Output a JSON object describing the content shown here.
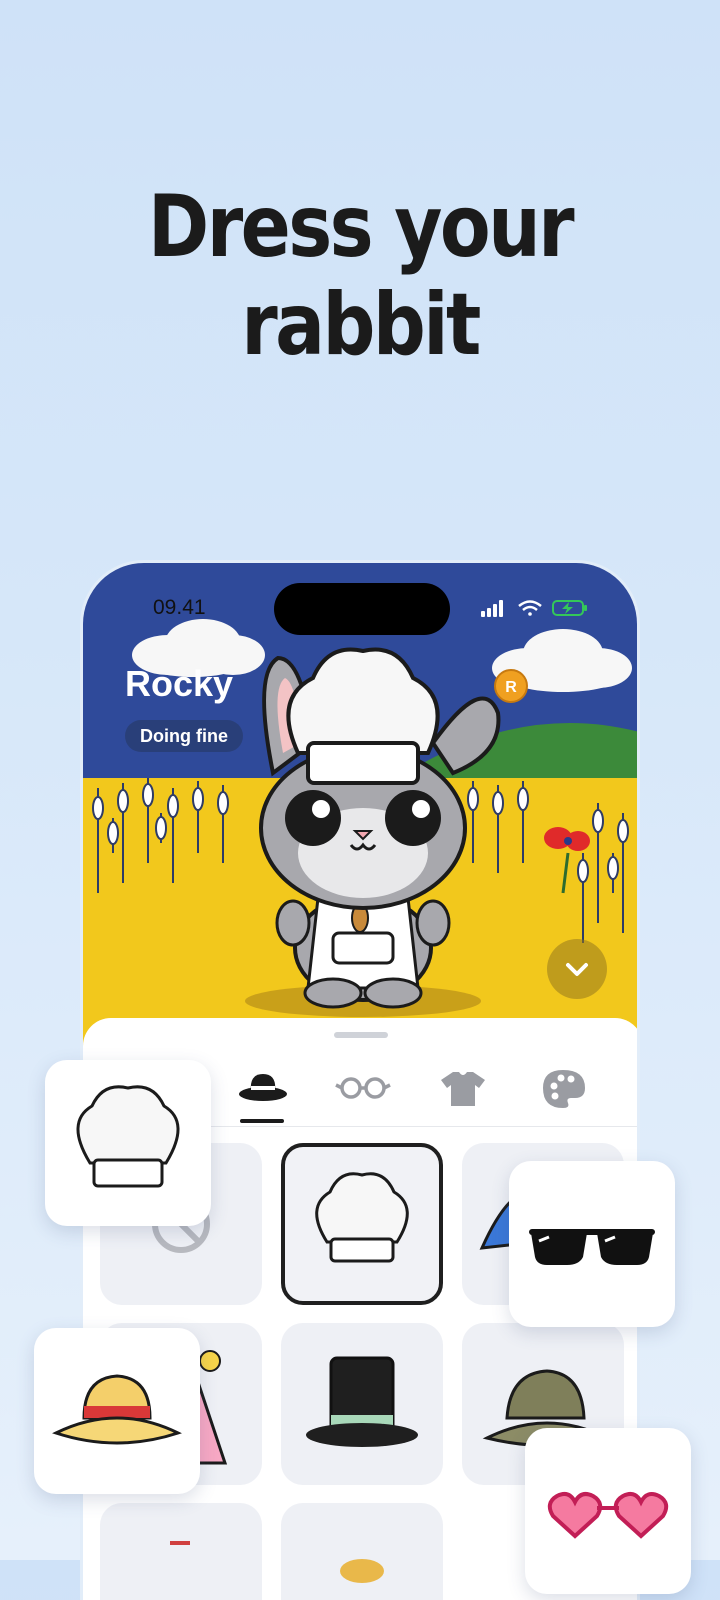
{
  "headline": {
    "line1": "Dress your",
    "line2": "rabbit"
  },
  "status_bar": {
    "time": "09.41",
    "icons": [
      "signal-icon",
      "wifi-icon",
      "battery-charging-icon"
    ]
  },
  "pet": {
    "name": "Rocky",
    "mood": "Doing fine",
    "currency_icon": "coin-icon",
    "currency_letter": "R"
  },
  "scene_actions": {
    "collapse_icon": "chevron-down-icon"
  },
  "tabs": [
    {
      "name": "hats",
      "icon": "hat-icon",
      "selected": true
    },
    {
      "name": "glasses",
      "icon": "glasses-icon",
      "selected": false
    },
    {
      "name": "clothes",
      "icon": "shirt-icon",
      "selected": false
    },
    {
      "name": "colors",
      "icon": "palette-icon",
      "selected": false
    }
  ],
  "items": [
    {
      "name": "none",
      "icon": "none-icon",
      "selected": false
    },
    {
      "name": "chef-hat",
      "icon": "chef-hat-icon",
      "selected": true
    },
    {
      "name": "wizard-hat",
      "icon": "wizard-hat-icon",
      "selected": false
    },
    {
      "name": "party-hat",
      "icon": "party-hat-icon",
      "selected": false
    },
    {
      "name": "top-hat",
      "icon": "top-hat-icon",
      "selected": false
    },
    {
      "name": "bucket-hat",
      "icon": "bucket-hat-icon",
      "selected": false
    },
    {
      "name": "item-7",
      "icon": "hat-icon",
      "selected": false
    },
    {
      "name": "item-8",
      "icon": "hat-icon",
      "selected": false
    }
  ],
  "floating_previews": [
    "chef-hat-icon",
    "sunglasses-icon",
    "straw-hat-icon",
    "heart-glasses-icon"
  ],
  "colors": {
    "sky": "#2f4a9a",
    "field": "#f2c81c",
    "hill": "#3c8a3a",
    "accent_dark": "#1b1b1b",
    "coin": "#f0a020"
  }
}
